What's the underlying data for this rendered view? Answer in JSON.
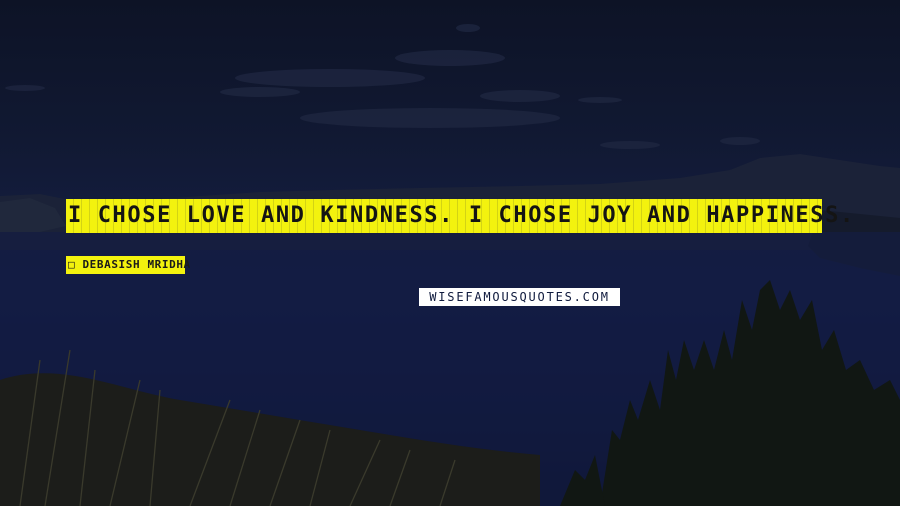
{
  "quote": {
    "text": "I chose love and kindness. I chose joy and happiness.",
    "author": "□ Debasish Mridha"
  },
  "watermark": {
    "text": "WISEFAMOUSQUOTES.COM"
  },
  "colors": {
    "highlight": "#f3f20e",
    "text": "#141414",
    "sky": "#111933",
    "lake": "#141d3f"
  }
}
